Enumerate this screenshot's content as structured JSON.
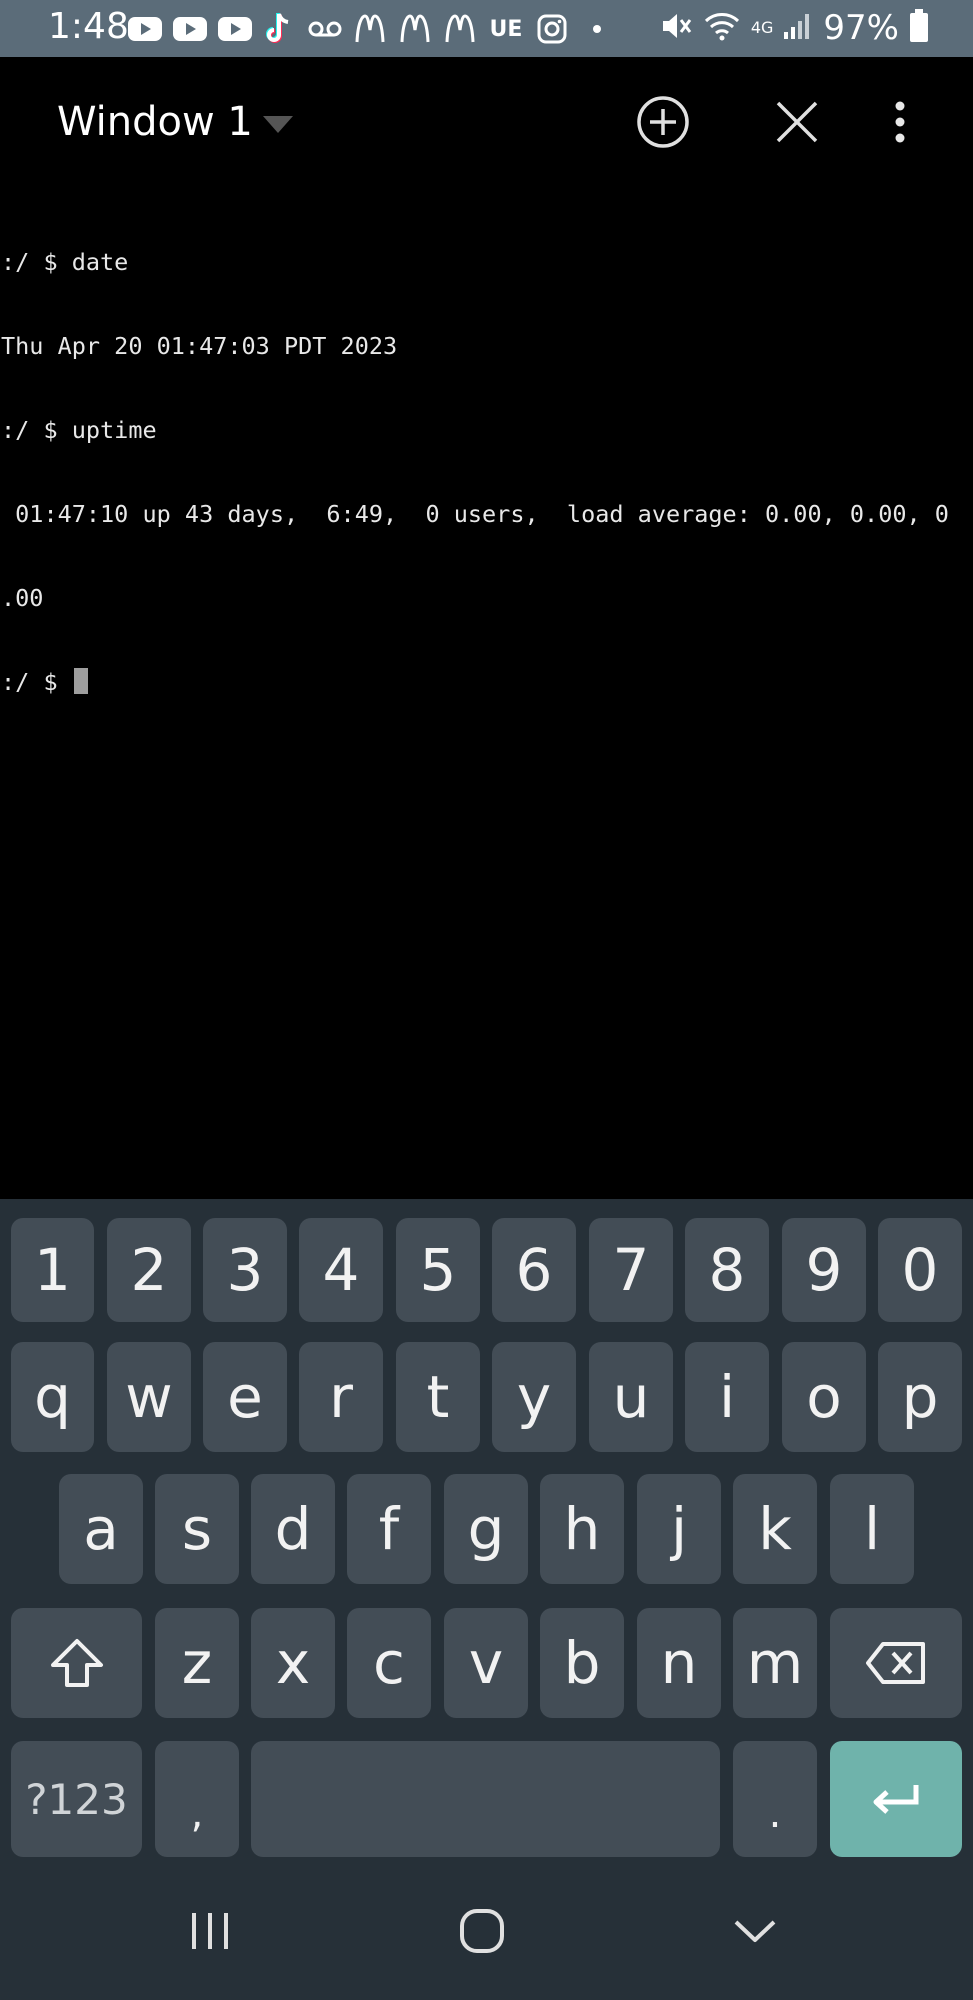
{
  "status_bar": {
    "time": "1:48",
    "notification_icons": [
      "youtube-icon",
      "youtube-icon",
      "youtube-icon",
      "tiktok-icon",
      "voicemail-icon",
      "mcdonalds-icon",
      "mcdonalds-icon",
      "mcdonalds-icon",
      "uber-eats-icon",
      "instagram-icon",
      "dot-icon"
    ],
    "ue_label": "UE",
    "network_label": "4G",
    "battery": "97%"
  },
  "toolbar": {
    "window_title": "Window 1"
  },
  "terminal": {
    "lines": [
      ":/ $ date",
      "Thu Apr 20 01:47:03 PDT 2023",
      ":/ $ uptime",
      " 01:47:10 up 43 days,  6:49,  0 users,  load average: 0.00, 0.00, 0",
      ".00",
      ":/ $ "
    ]
  },
  "keyboard": {
    "row1": [
      "1",
      "2",
      "3",
      "4",
      "5",
      "6",
      "7",
      "8",
      "9",
      "0"
    ],
    "row2": [
      "q",
      "w",
      "e",
      "r",
      "t",
      "y",
      "u",
      "i",
      "o",
      "p"
    ],
    "row3": [
      "a",
      "s",
      "d",
      "f",
      "g",
      "h",
      "j",
      "k",
      "l"
    ],
    "row4": [
      "z",
      "x",
      "c",
      "v",
      "b",
      "n",
      "m"
    ],
    "symbols_label": "?123",
    "comma": ",",
    "period": "."
  },
  "colors": {
    "status_bar": "#5b6c79",
    "keyboard_bg": "#263038",
    "key_bg": "#434d56",
    "enter_key": "#6fb3ab"
  }
}
